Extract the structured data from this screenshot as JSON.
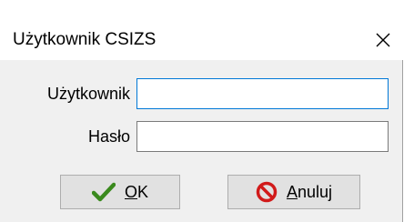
{
  "window": {
    "title": "Użytkownik CSIZS"
  },
  "form": {
    "user_label": "Użytkownik",
    "user_value": "",
    "password_label": "Hasło",
    "password_value": ""
  },
  "buttons": {
    "ok_label_first": "O",
    "ok_label_rest": "K",
    "cancel_label_first": "A",
    "cancel_label_rest": "nuluj"
  },
  "icons": {
    "ok": "checkmark-icon",
    "cancel": "no-entry-icon",
    "close": "close-icon"
  },
  "colors": {
    "ok_check": "#3a8a1e",
    "cancel_red": "#d11a1a",
    "focus_border": "#0078d7"
  }
}
